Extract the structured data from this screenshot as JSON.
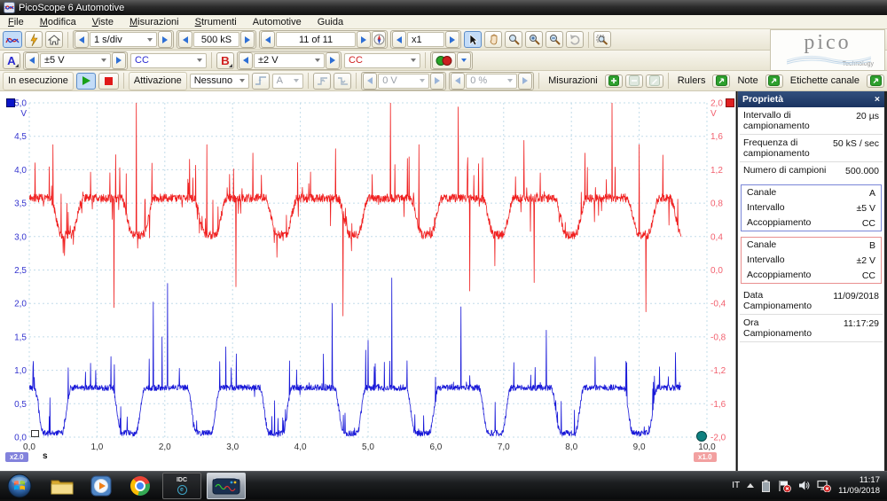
{
  "window": {
    "title": "PicoScope 6 Automotive"
  },
  "menu": {
    "items": [
      "File",
      "Modifica",
      "Viste",
      "Misurazioni",
      "Strumenti",
      "Automotive",
      "Guida"
    ]
  },
  "toolbar": {
    "timebase": "1 s/div",
    "samples": "500 kS",
    "buffer": "11 of 11",
    "zoom": "x1",
    "run_label": "In esecuzione",
    "trigger_label": "Attivazione",
    "trigger_mode": "Nessuno",
    "trigger_source": "A",
    "trigger_level": "0 V",
    "trigger_pre": "0 %",
    "measurements_label": "Misurazioni",
    "rulers_label": "Rulers",
    "note_label": "Note",
    "channel_labels_label": "Etichette canale"
  },
  "channels": {
    "a": {
      "name": "A",
      "range": "±5 V",
      "coupling": "CC"
    },
    "b": {
      "name": "B",
      "range": "±2 V",
      "coupling": "CC"
    }
  },
  "logo": {
    "name": "pico",
    "sub": "Technology"
  },
  "properties": {
    "title": "Proprietà",
    "close": "×",
    "rows": [
      {
        "label": "Intervallo di campionamento",
        "value": "20 µs"
      },
      {
        "label": "Frequenza di campionamento",
        "value": "50 kS / sec"
      },
      {
        "label": "Numero di campioni",
        "value": "500.000"
      }
    ],
    "channel_a": {
      "rows": [
        {
          "label": "Canale",
          "value": "A"
        },
        {
          "label": "Intervallo",
          "value": "±5 V"
        },
        {
          "label": "Accoppiamento",
          "value": "CC"
        }
      ]
    },
    "channel_b": {
      "rows": [
        {
          "label": "Canale",
          "value": "B"
        },
        {
          "label": "Intervallo",
          "value": "±2 V"
        },
        {
          "label": "Accoppiamento",
          "value": "CC"
        }
      ]
    },
    "date_row": {
      "label": "Data Campionamento",
      "value": "11/09/2018"
    },
    "time_row": {
      "label": "Ora Campionamento",
      "value": "11:17:29"
    }
  },
  "taskbar": {
    "lang": "IT",
    "time": "11:17",
    "date": "11/09/2018"
  },
  "chart_data": {
    "type": "line",
    "title": "",
    "grid": true,
    "grid_color": "#c2dcea",
    "badges": {
      "left": "x2.0",
      "right": "x1.0"
    },
    "x_axis": {
      "unit": "s",
      "min": 0,
      "max": 10,
      "ticks": [
        {
          "v": 0,
          "l": "0,0"
        },
        {
          "v": 1,
          "l": "1,0"
        },
        {
          "v": 2,
          "l": "2,0"
        },
        {
          "v": 3,
          "l": "3,0"
        },
        {
          "v": 4,
          "l": "4,0"
        },
        {
          "v": 5,
          "l": "5,0"
        },
        {
          "v": 6,
          "l": "6,0"
        },
        {
          "v": 7,
          "l": "7,0"
        },
        {
          "v": 8,
          "l": "8,0"
        },
        {
          "v": 9,
          "l": "9,0"
        },
        {
          "v": 10,
          "l": "10,0"
        }
      ]
    },
    "left_axis": {
      "unit": "V",
      "min": 0,
      "max": 5,
      "color": "#3434cf",
      "ticks": [
        {
          "v": 5,
          "l": "5,0"
        },
        {
          "v": 4.5,
          "l": "4,5"
        },
        {
          "v": 4,
          "l": "4,0"
        },
        {
          "v": 3.5,
          "l": "3,5"
        },
        {
          "v": 3,
          "l": "3,0"
        },
        {
          "v": 2.5,
          "l": "2,5"
        },
        {
          "v": 2,
          "l": "2,0"
        },
        {
          "v": 1.5,
          "l": "1,5"
        },
        {
          "v": 1,
          "l": "1,0"
        },
        {
          "v": 0.5,
          "l": "0,5"
        },
        {
          "v": 0,
          "l": "0,0"
        }
      ]
    },
    "right_axis": {
      "unit": "V",
      "min": -2,
      "max": 2,
      "color": "#f2606e",
      "ticks": [
        {
          "v": 2,
          "l": "2,0"
        },
        {
          "v": 1.6,
          "l": "1,6"
        },
        {
          "v": 1.2,
          "l": "1,2"
        },
        {
          "v": 0.8,
          "l": "0,8"
        },
        {
          "v": 0.4,
          "l": "0,4"
        },
        {
          "v": 0,
          "l": "0,0"
        },
        {
          "v": -0.4,
          "l": "-0,4"
        },
        {
          "v": -0.8,
          "l": "-0,8"
        },
        {
          "v": -1.2,
          "l": "-1,2"
        },
        {
          "v": -1.6,
          "l": "-1,6"
        },
        {
          "v": -2,
          "l": "-2,0"
        }
      ]
    },
    "sample_step": 0.005,
    "noise_seed": 42,
    "series": [
      {
        "name": "canale-a",
        "axis": "left",
        "color": "#1818d8",
        "t_start": 0,
        "t_end": 9.62,
        "high": 0.74,
        "low": 0.06,
        "ramp": 0.14,
        "dips": [
          [
            0.07,
            0.62
          ],
          [
            1.22,
            1.71
          ],
          [
            2.33,
            2.82
          ],
          [
            3.4,
            3.88
          ],
          [
            4.5,
            4.97
          ],
          [
            5.56,
            6.04
          ],
          [
            6.63,
            7.11
          ],
          [
            7.7,
            8.19
          ],
          [
            8.77,
            9.27
          ]
        ],
        "noise": 0.045,
        "spike_p": 0.07,
        "spike_up_ratio": 0.8,
        "spike_up": 0.55,
        "spike_down": 0.12,
        "big_spikes": [
          [
            1.83,
            2.02
          ],
          [
            1.96,
            1.5
          ],
          [
            2.04,
            2.3
          ],
          [
            2.9,
            1.35
          ],
          [
            4.47,
            2.0
          ],
          [
            5.0,
            1.45
          ],
          [
            5.35,
            2.38
          ],
          [
            6.37,
            1.95
          ],
          [
            7.63,
            1.6
          ],
          [
            8.35,
            1.2
          ],
          [
            9.3,
            1.05
          ]
        ]
      },
      {
        "name": "canale-b",
        "axis": "right",
        "color": "#f02020",
        "t_start": 0,
        "t_end": 9.62,
        "high": 0.86,
        "low": 0.42,
        "ramp": 0.18,
        "dips": [
          [
            0.3,
            0.8
          ],
          [
            1.35,
            1.85
          ],
          [
            2.42,
            2.92
          ],
          [
            3.48,
            3.96
          ],
          [
            4.55,
            5.02
          ],
          [
            5.62,
            6.1
          ],
          [
            6.68,
            7.16
          ],
          [
            7.75,
            8.23
          ],
          [
            8.82,
            9.3
          ],
          [
            9.45,
            9.8
          ]
        ],
        "noise": 0.05,
        "spike_p": 0.09,
        "spike_up_ratio": 0.6,
        "spike_up": 0.5,
        "spike_down": 0.35,
        "big_spikes": [
          [
            0.35,
            1.5
          ],
          [
            1.25,
            -0.45
          ],
          [
            1.58,
            2.0
          ],
          [
            2.62,
            1.5
          ],
          [
            3.05,
            -0.2
          ],
          [
            3.3,
            1.4
          ],
          [
            4.52,
            1.45
          ],
          [
            4.63,
            -0.55
          ],
          [
            5.33,
            2.0
          ],
          [
            5.75,
            1.5
          ],
          [
            6.33,
            1.95
          ],
          [
            6.5,
            -0.25
          ],
          [
            7.3,
            1.55
          ],
          [
            7.45,
            -0.15
          ],
          [
            8.2,
            1.4
          ],
          [
            8.6,
            2.0
          ],
          [
            9.0,
            1.5
          ],
          [
            9.1,
            -0.5
          ]
        ]
      }
    ]
  }
}
